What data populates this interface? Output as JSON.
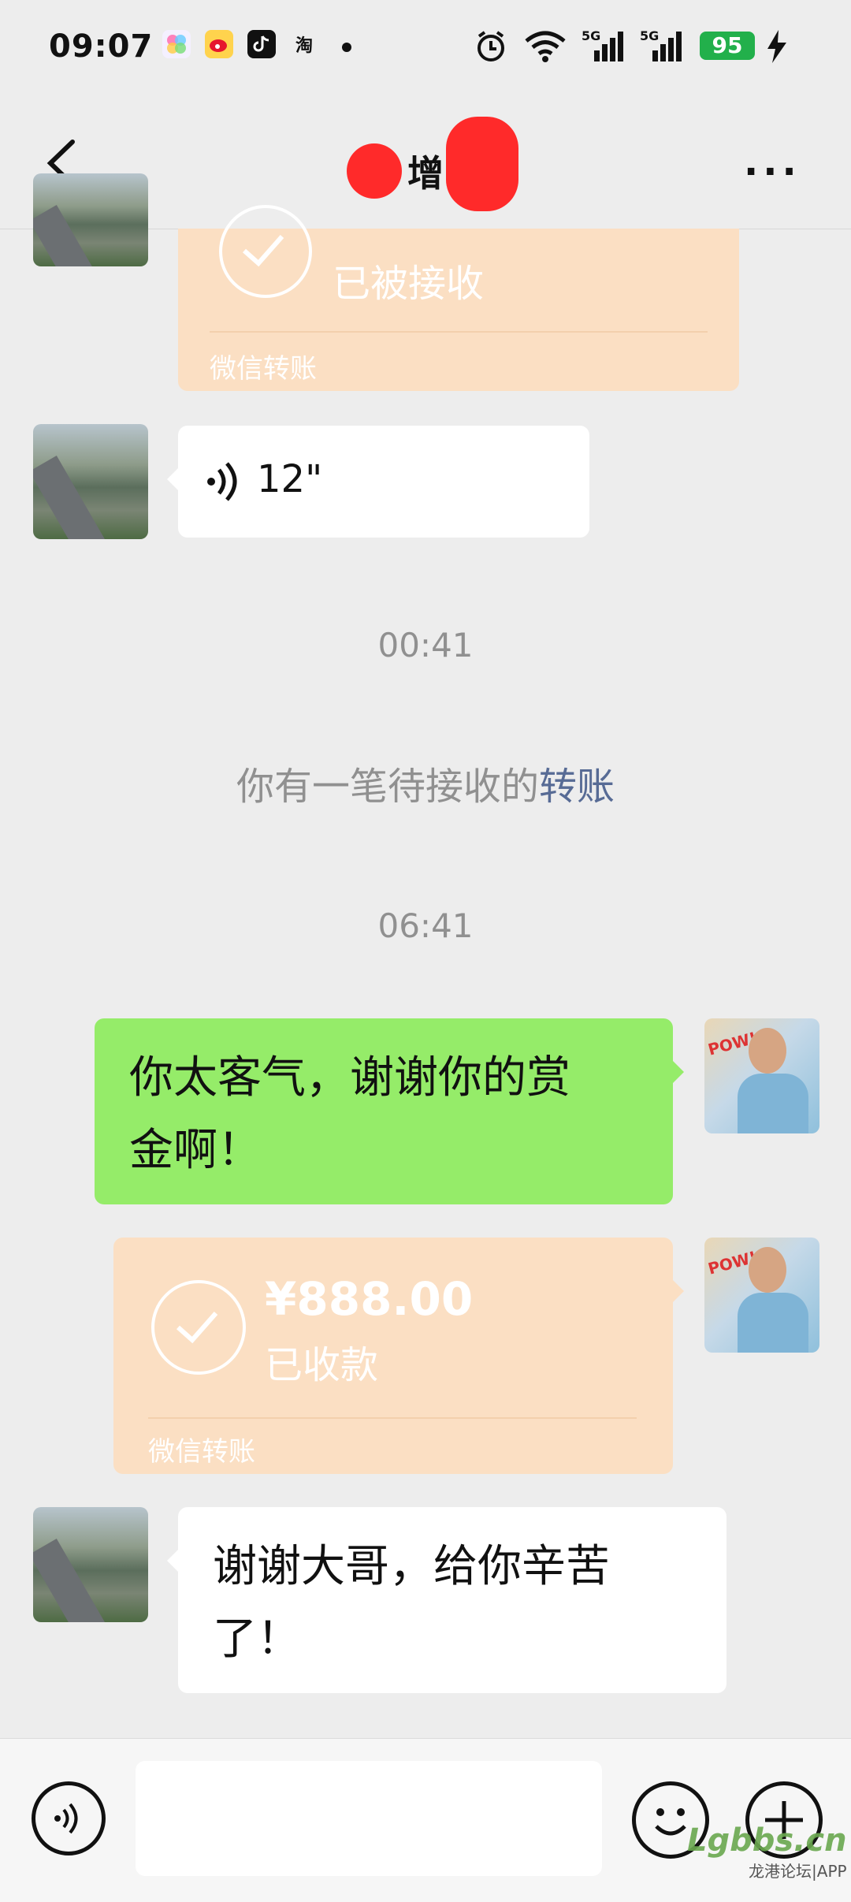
{
  "status_bar": {
    "time": "09:07",
    "app_icons": [
      "photos-icon",
      "weibo-icon",
      "tiktok-icon",
      "taobao-icon"
    ],
    "taobao_glyph": "淘",
    "signal_1": "5G",
    "signal_2": "5G",
    "battery": "95"
  },
  "header": {
    "title_visible": "增",
    "more": "···"
  },
  "messages": {
    "transfer_top": {
      "status": "已被接收",
      "label": "微信转账"
    },
    "voice": {
      "duration": "12\""
    },
    "time_1": "00:41",
    "system_notice": {
      "text": "你有一笔待接收的",
      "link": "转账"
    },
    "time_2": "06:41",
    "sent_text": {
      "line1": "你太客气，谢谢你的赏",
      "line2": "金啊！"
    },
    "transfer_sent": {
      "amount": "¥888.00",
      "status": "已收款",
      "label": "微信转账"
    },
    "received_text": {
      "line1": "谢谢大哥，给你辛苦",
      "line2": "了！"
    }
  },
  "watermark": {
    "brand": "Lgbbs.cn",
    "caption": "龙港论坛|APP"
  },
  "colors": {
    "background": "#ededed",
    "green_bubble": "#95ec69",
    "transfer_bubble": "#fbdfc3",
    "link": "#576b95",
    "battery": "#22b04b"
  }
}
